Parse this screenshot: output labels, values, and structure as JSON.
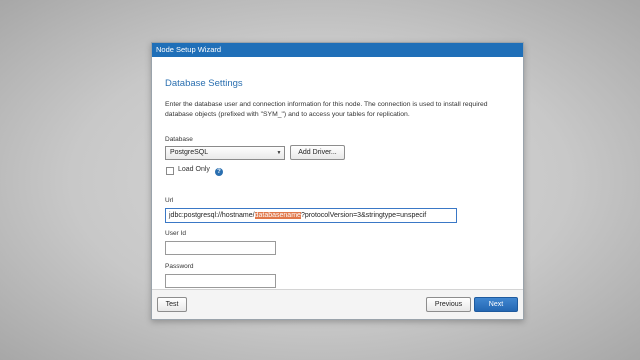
{
  "window": {
    "title": "Node Setup Wizard"
  },
  "section": {
    "heading": "Database Settings",
    "description": "Enter the database user and connection information for this node. The connection is used to install required database objects (prefixed with \"SYM_\") and to access your tables for replication."
  },
  "database": {
    "label": "Database",
    "selected": "PostgreSQL",
    "add_driver_label": "Add Driver..."
  },
  "load_only": {
    "label": "Load Only",
    "checked": false
  },
  "url": {
    "label": "Url",
    "value_before": "jdbc:postgresql://hostname/",
    "value_selected": "databasename",
    "value_after": "?protocolVersion=3&stringtype=unspecif"
  },
  "user_id": {
    "label": "User Id",
    "value": ""
  },
  "password": {
    "label": "Password",
    "value": ""
  },
  "footer": {
    "test_label": "Test",
    "previous_label": "Previous",
    "next_label": "Next"
  },
  "colors": {
    "titlebar": "#1f6fb8",
    "accent": "#2a6fb0",
    "selection": "#e0774a"
  }
}
